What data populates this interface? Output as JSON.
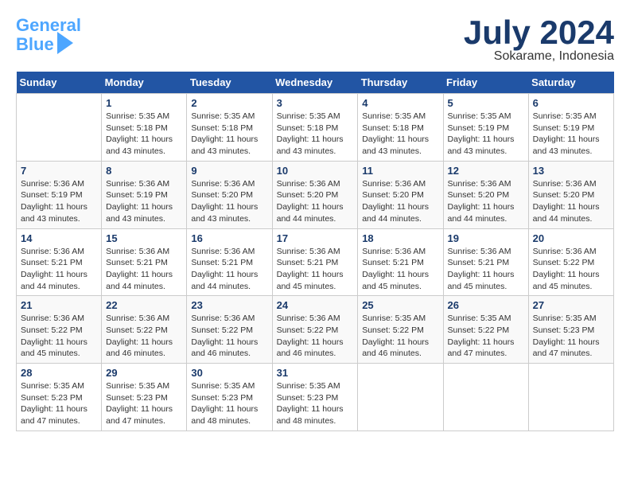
{
  "header": {
    "logo_line1": "General",
    "logo_line2": "Blue",
    "month": "July 2024",
    "location": "Sokarame, Indonesia"
  },
  "weekdays": [
    "Sunday",
    "Monday",
    "Tuesday",
    "Wednesday",
    "Thursday",
    "Friday",
    "Saturday"
  ],
  "weeks": [
    [
      {
        "day": "",
        "info": ""
      },
      {
        "day": "1",
        "info": "Sunrise: 5:35 AM\nSunset: 5:18 PM\nDaylight: 11 hours\nand 43 minutes."
      },
      {
        "day": "2",
        "info": "Sunrise: 5:35 AM\nSunset: 5:18 PM\nDaylight: 11 hours\nand 43 minutes."
      },
      {
        "day": "3",
        "info": "Sunrise: 5:35 AM\nSunset: 5:18 PM\nDaylight: 11 hours\nand 43 minutes."
      },
      {
        "day": "4",
        "info": "Sunrise: 5:35 AM\nSunset: 5:18 PM\nDaylight: 11 hours\nand 43 minutes."
      },
      {
        "day": "5",
        "info": "Sunrise: 5:35 AM\nSunset: 5:19 PM\nDaylight: 11 hours\nand 43 minutes."
      },
      {
        "day": "6",
        "info": "Sunrise: 5:35 AM\nSunset: 5:19 PM\nDaylight: 11 hours\nand 43 minutes."
      }
    ],
    [
      {
        "day": "7",
        "info": "Sunrise: 5:36 AM\nSunset: 5:19 PM\nDaylight: 11 hours\nand 43 minutes."
      },
      {
        "day": "8",
        "info": "Sunrise: 5:36 AM\nSunset: 5:19 PM\nDaylight: 11 hours\nand 43 minutes."
      },
      {
        "day": "9",
        "info": "Sunrise: 5:36 AM\nSunset: 5:20 PM\nDaylight: 11 hours\nand 43 minutes."
      },
      {
        "day": "10",
        "info": "Sunrise: 5:36 AM\nSunset: 5:20 PM\nDaylight: 11 hours\nand 44 minutes."
      },
      {
        "day": "11",
        "info": "Sunrise: 5:36 AM\nSunset: 5:20 PM\nDaylight: 11 hours\nand 44 minutes."
      },
      {
        "day": "12",
        "info": "Sunrise: 5:36 AM\nSunset: 5:20 PM\nDaylight: 11 hours\nand 44 minutes."
      },
      {
        "day": "13",
        "info": "Sunrise: 5:36 AM\nSunset: 5:20 PM\nDaylight: 11 hours\nand 44 minutes."
      }
    ],
    [
      {
        "day": "14",
        "info": "Sunrise: 5:36 AM\nSunset: 5:21 PM\nDaylight: 11 hours\nand 44 minutes."
      },
      {
        "day": "15",
        "info": "Sunrise: 5:36 AM\nSunset: 5:21 PM\nDaylight: 11 hours\nand 44 minutes."
      },
      {
        "day": "16",
        "info": "Sunrise: 5:36 AM\nSunset: 5:21 PM\nDaylight: 11 hours\nand 44 minutes."
      },
      {
        "day": "17",
        "info": "Sunrise: 5:36 AM\nSunset: 5:21 PM\nDaylight: 11 hours\nand 45 minutes."
      },
      {
        "day": "18",
        "info": "Sunrise: 5:36 AM\nSunset: 5:21 PM\nDaylight: 11 hours\nand 45 minutes."
      },
      {
        "day": "19",
        "info": "Sunrise: 5:36 AM\nSunset: 5:21 PM\nDaylight: 11 hours\nand 45 minutes."
      },
      {
        "day": "20",
        "info": "Sunrise: 5:36 AM\nSunset: 5:22 PM\nDaylight: 11 hours\nand 45 minutes."
      }
    ],
    [
      {
        "day": "21",
        "info": "Sunrise: 5:36 AM\nSunset: 5:22 PM\nDaylight: 11 hours\nand 45 minutes."
      },
      {
        "day": "22",
        "info": "Sunrise: 5:36 AM\nSunset: 5:22 PM\nDaylight: 11 hours\nand 46 minutes."
      },
      {
        "day": "23",
        "info": "Sunrise: 5:36 AM\nSunset: 5:22 PM\nDaylight: 11 hours\nand 46 minutes."
      },
      {
        "day": "24",
        "info": "Sunrise: 5:36 AM\nSunset: 5:22 PM\nDaylight: 11 hours\nand 46 minutes."
      },
      {
        "day": "25",
        "info": "Sunrise: 5:35 AM\nSunset: 5:22 PM\nDaylight: 11 hours\nand 46 minutes."
      },
      {
        "day": "26",
        "info": "Sunrise: 5:35 AM\nSunset: 5:22 PM\nDaylight: 11 hours\nand 47 minutes."
      },
      {
        "day": "27",
        "info": "Sunrise: 5:35 AM\nSunset: 5:23 PM\nDaylight: 11 hours\nand 47 minutes."
      }
    ],
    [
      {
        "day": "28",
        "info": "Sunrise: 5:35 AM\nSunset: 5:23 PM\nDaylight: 11 hours\nand 47 minutes."
      },
      {
        "day": "29",
        "info": "Sunrise: 5:35 AM\nSunset: 5:23 PM\nDaylight: 11 hours\nand 47 minutes."
      },
      {
        "day": "30",
        "info": "Sunrise: 5:35 AM\nSunset: 5:23 PM\nDaylight: 11 hours\nand 48 minutes."
      },
      {
        "day": "31",
        "info": "Sunrise: 5:35 AM\nSunset: 5:23 PM\nDaylight: 11 hours\nand 48 minutes."
      },
      {
        "day": "",
        "info": ""
      },
      {
        "day": "",
        "info": ""
      },
      {
        "day": "",
        "info": ""
      }
    ]
  ]
}
